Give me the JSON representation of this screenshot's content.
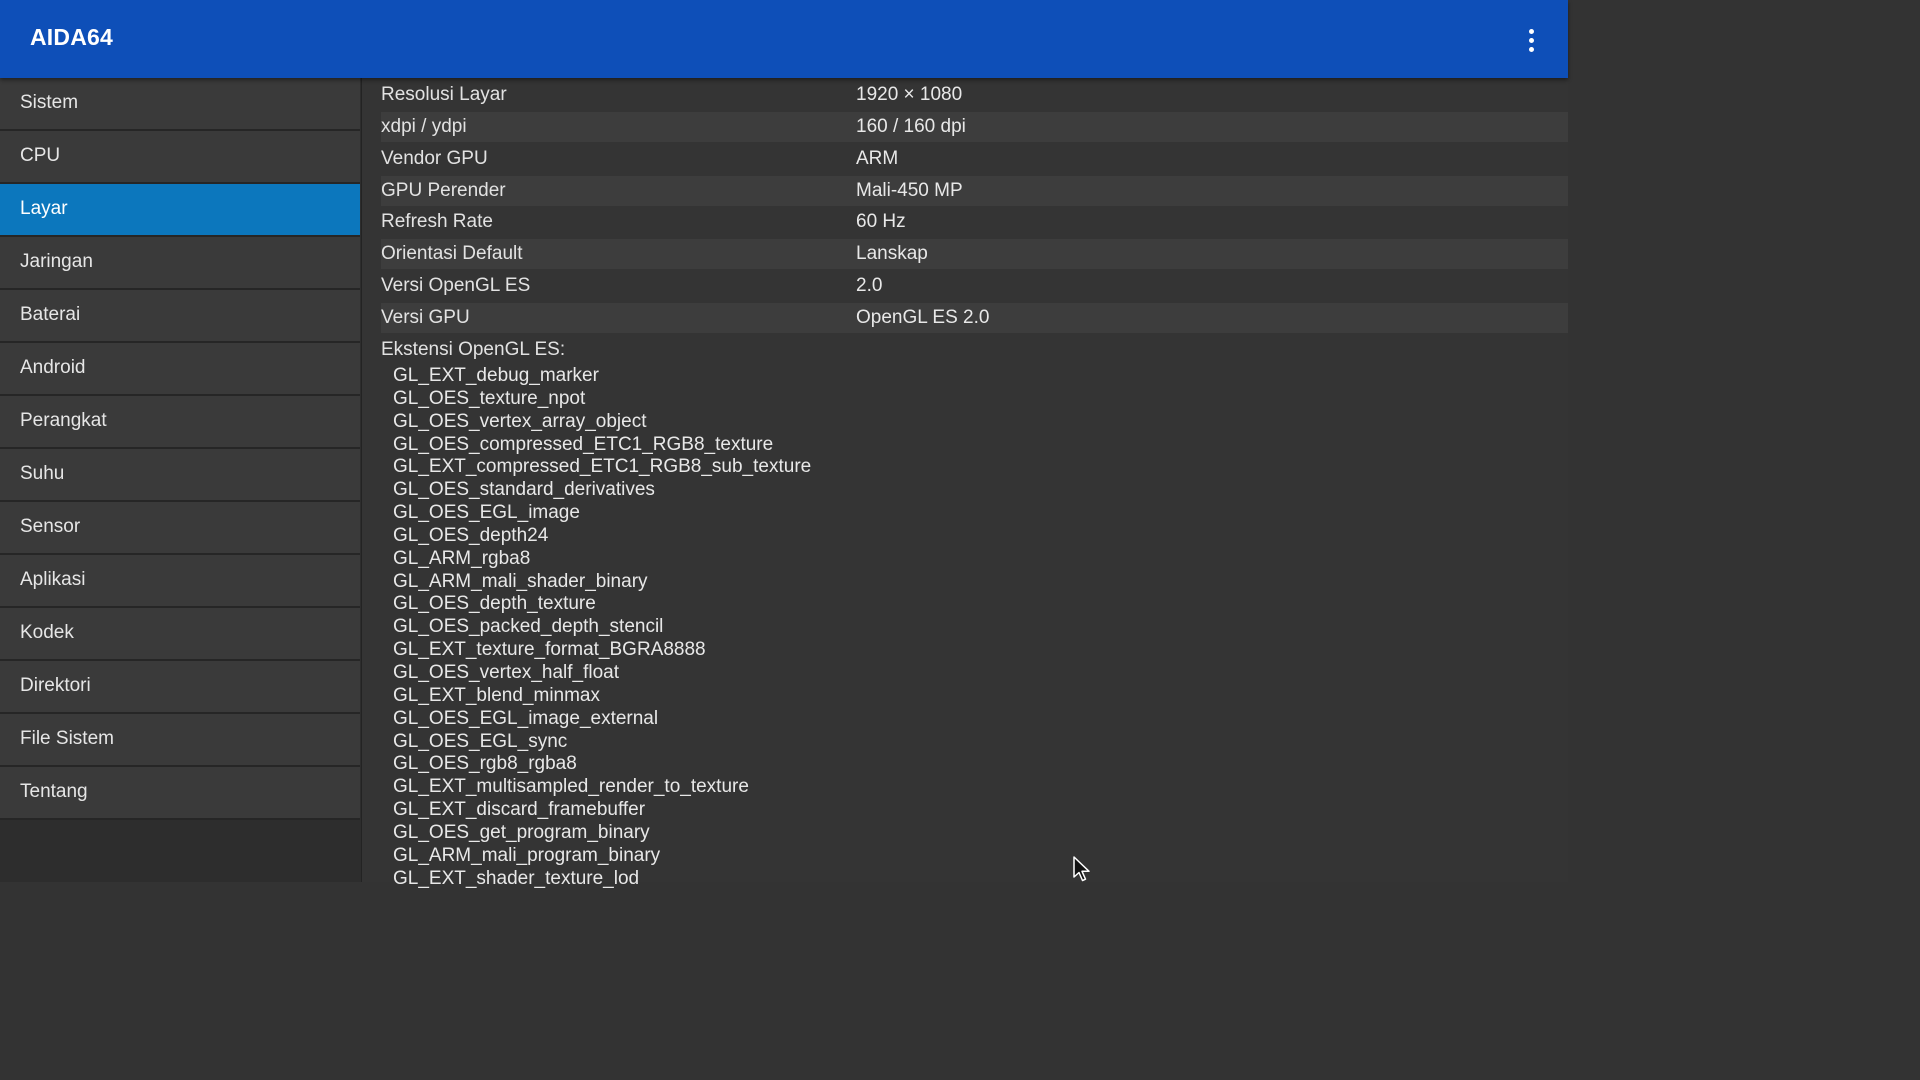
{
  "app": {
    "title": "AIDA64"
  },
  "sidebar": {
    "items": [
      {
        "label": "Sistem",
        "selected": false
      },
      {
        "label": "CPU",
        "selected": false
      },
      {
        "label": "Layar",
        "selected": true
      },
      {
        "label": "Jaringan",
        "selected": false
      },
      {
        "label": "Baterai",
        "selected": false
      },
      {
        "label": "Android",
        "selected": false
      },
      {
        "label": "Perangkat",
        "selected": false
      },
      {
        "label": "Suhu",
        "selected": false
      },
      {
        "label": "Sensor",
        "selected": false
      },
      {
        "label": "Aplikasi",
        "selected": false
      },
      {
        "label": "Kodek",
        "selected": false
      },
      {
        "label": "Direktori",
        "selected": false
      },
      {
        "label": "File Sistem",
        "selected": false
      },
      {
        "label": "Tentang",
        "selected": false
      }
    ]
  },
  "display": {
    "properties": [
      {
        "name": "Resolusi Layar",
        "value": "1920 × 1080"
      },
      {
        "name": "xdpi / ydpi",
        "value": "160 / 160 dpi"
      },
      {
        "name": "Vendor GPU",
        "value": "ARM"
      },
      {
        "name": "GPU Perender",
        "value": "Mali-450 MP"
      },
      {
        "name": "Refresh Rate",
        "value": "60 Hz"
      },
      {
        "name": "Orientasi Default",
        "value": "Lanskap"
      },
      {
        "name": "Versi OpenGL ES",
        "value": "2.0"
      },
      {
        "name": "Versi GPU",
        "value": "OpenGL ES 2.0"
      }
    ],
    "extensions_header": "Ekstensi OpenGL ES:",
    "extensions": [
      "GL_EXT_debug_marker",
      "GL_OES_texture_npot",
      "GL_OES_vertex_array_object",
      "GL_OES_compressed_ETC1_RGB8_texture",
      "GL_EXT_compressed_ETC1_RGB8_sub_texture",
      "GL_OES_standard_derivatives",
      "GL_OES_EGL_image",
      "GL_OES_depth24",
      "GL_ARM_rgba8",
      "GL_ARM_mali_shader_binary",
      "GL_OES_depth_texture",
      "GL_OES_packed_depth_stencil",
      "GL_EXT_texture_format_BGRA8888",
      "GL_OES_vertex_half_float",
      "GL_EXT_blend_minmax",
      "GL_OES_EGL_image_external",
      "GL_OES_EGL_sync",
      "GL_OES_rgb8_rgba8",
      "GL_EXT_multisampled_render_to_texture",
      "GL_EXT_discard_framebuffer",
      "GL_OES_get_program_binary",
      "GL_ARM_mali_program_binary",
      "GL_EXT_shader_texture_lod"
    ]
  },
  "icons": {
    "overflow_menu": "more-vert-icon",
    "cursor": "mouse-pointer-icon"
  },
  "colors": {
    "appbar": "#0e4fb8",
    "selected_item": "#0c77bd",
    "background": "#333333"
  }
}
